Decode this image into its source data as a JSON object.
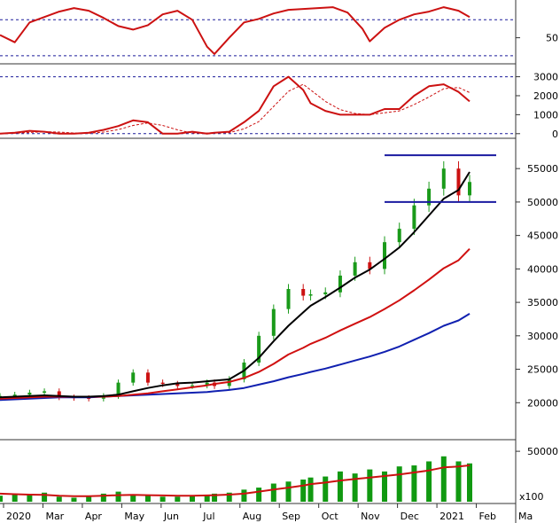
{
  "colors": {
    "background": "#ffffff",
    "price_up": "#1a9a1a",
    "price_down": "#cc1111",
    "ma_short": "#000000",
    "ma_mid": "#d01010",
    "ma_long": "#1020b0",
    "guide": "#1a1aa0",
    "volume_bar": "#119911",
    "volume_ma": "#cc1111",
    "osc": "#cc1111",
    "osc_ref": "#1a1a9a"
  },
  "chart_data": [
    {
      "panel": "rsi",
      "type": "line",
      "y_ticks": [
        "50"
      ],
      "ref_levels": [
        30,
        70
      ],
      "ylim": [
        23,
        88
      ],
      "x": [
        0,
        4,
        8,
        12,
        16,
        20,
        24,
        28,
        32,
        36,
        40,
        44,
        48,
        52,
        56,
        58,
        62,
        66,
        70,
        74,
        78,
        82,
        86,
        90,
        94,
        98,
        100,
        104,
        108,
        112,
        116,
        120,
        124,
        127
      ],
      "values": [
        53,
        45,
        67,
        73,
        79,
        83,
        80,
        72,
        63,
        59,
        64,
        76,
        80,
        70,
        40,
        32,
        50,
        67,
        71,
        77,
        81,
        82,
        83,
        84,
        78,
        60,
        46,
        61,
        70,
        76,
        79,
        84,
        80,
        73
      ],
      "grid": false,
      "legend": "none"
    },
    {
      "panel": "oscillator",
      "type": "line",
      "y_ticks": [
        "3000",
        "2000",
        "1000",
        "0"
      ],
      "ref_levels": [
        0,
        3000
      ],
      "ylim": [
        -150,
        3400
      ],
      "x": [
        0,
        4,
        8,
        12,
        16,
        20,
        24,
        28,
        32,
        36,
        40,
        44,
        48,
        52,
        56,
        58,
        62,
        66,
        70,
        74,
        78,
        82,
        84,
        88,
        92,
        96,
        100,
        104,
        108,
        112,
        116,
        120,
        124,
        127
      ],
      "values": [
        0,
        50,
        150,
        100,
        0,
        0,
        50,
        200,
        400,
        700,
        600,
        0,
        0,
        100,
        0,
        50,
        100,
        600,
        1200,
        2500,
        3000,
        2300,
        1600,
        1200,
        1000,
        1000,
        1000,
        1300,
        1300,
        2000,
        2500,
        2600,
        2200,
        1700
      ],
      "grid": false,
      "legend": "none"
    },
    {
      "panel": "price",
      "type": "candlestick",
      "y_ticks": [
        "55000",
        "50000",
        "45000",
        "40000",
        "35000",
        "30000",
        "25000",
        "20000"
      ],
      "ylim": [
        15000,
        59000
      ],
      "x_ticks": [
        "2020",
        "Mar",
        "Apr",
        "May",
        "Jun",
        "Jul",
        "Aug",
        "Sep",
        "Oct",
        "Nov",
        "Dec",
        "2021",
        "Feb",
        "Ma"
      ],
      "x": [
        0,
        4,
        8,
        12,
        16,
        20,
        24,
        28,
        32,
        36,
        40,
        44,
        48,
        52,
        56,
        58,
        62,
        66,
        70,
        74,
        78,
        82,
        84,
        88,
        92,
        96,
        100,
        104,
        108,
        112,
        116,
        120,
        124,
        127
      ],
      "close": [
        21000,
        21200,
        21500,
        21700,
        20800,
        20700,
        20600,
        21000,
        23000,
        24500,
        23000,
        22800,
        22500,
        22600,
        23000,
        22500,
        23500,
        26000,
        30000,
        34000,
        37000,
        36000,
        36200,
        36500,
        39000,
        41000,
        40000,
        44000,
        46000,
        49500,
        52000,
        55000,
        51000,
        53000
      ],
      "ma_short": [
        20800,
        20900,
        21000,
        21100,
        21000,
        20900,
        20900,
        21000,
        21200,
        21700,
        22200,
        22600,
        22900,
        23000,
        23200,
        23300,
        23500,
        24800,
        26700,
        29200,
        31500,
        33500,
        34500,
        35800,
        37200,
        38700,
        39900,
        41500,
        43200,
        45500,
        48000,
        50500,
        51800,
        54500
      ],
      "ma_mid": [
        20600,
        20700,
        20800,
        20900,
        20900,
        20900,
        20900,
        20900,
        21000,
        21200,
        21400,
        21700,
        22000,
        22300,
        22600,
        22800,
        23100,
        23700,
        24600,
        25800,
        27200,
        28200,
        28800,
        29700,
        30800,
        31800,
        32800,
        34000,
        35300,
        36800,
        38400,
        40100,
        41300,
        43000
      ],
      "ma_long": [
        20400,
        20500,
        20600,
        20700,
        20800,
        20800,
        20800,
        20900,
        21000,
        21100,
        21200,
        21300,
        21400,
        21500,
        21600,
        21700,
        21900,
        22200,
        22700,
        23200,
        23800,
        24300,
        24600,
        25100,
        25700,
        26300,
        26900,
        27600,
        28400,
        29400,
        30400,
        31500,
        32300,
        33300
      ],
      "channel_top": 57000,
      "channel_bottom": 50000,
      "grid": false,
      "legend": "none"
    },
    {
      "panel": "volume",
      "type": "bar",
      "y_ticks": [
        "50000"
      ],
      "unit_label": "x100",
      "ylim": [
        0,
        58000
      ],
      "x": [
        0,
        4,
        8,
        12,
        16,
        20,
        24,
        28,
        32,
        36,
        40,
        44,
        48,
        52,
        56,
        58,
        62,
        66,
        70,
        74,
        78,
        82,
        84,
        88,
        92,
        96,
        100,
        104,
        108,
        112,
        116,
        120,
        124,
        127
      ],
      "values": [
        6000,
        8000,
        7000,
        9000,
        5000,
        4000,
        6000,
        8000,
        10000,
        7000,
        6000,
        5000,
        5000,
        6000,
        7000,
        8000,
        9000,
        12000,
        14000,
        18000,
        20000,
        22000,
        24000,
        25000,
        30000,
        28000,
        32000,
        30000,
        35000,
        36000,
        40000,
        45000,
        40000,
        38000
      ],
      "ma": [
        8000,
        7500,
        7000,
        6800,
        6000,
        5500,
        5500,
        6000,
        6500,
        6800,
        6500,
        6200,
        6000,
        6000,
        6200,
        6500,
        7000,
        8000,
        10000,
        12000,
        14000,
        16000,
        17500,
        19000,
        21000,
        22500,
        24000,
        25500,
        27000,
        29000,
        31000,
        34000,
        35000,
        36000
      ],
      "grid": false,
      "legend": "none"
    }
  ]
}
